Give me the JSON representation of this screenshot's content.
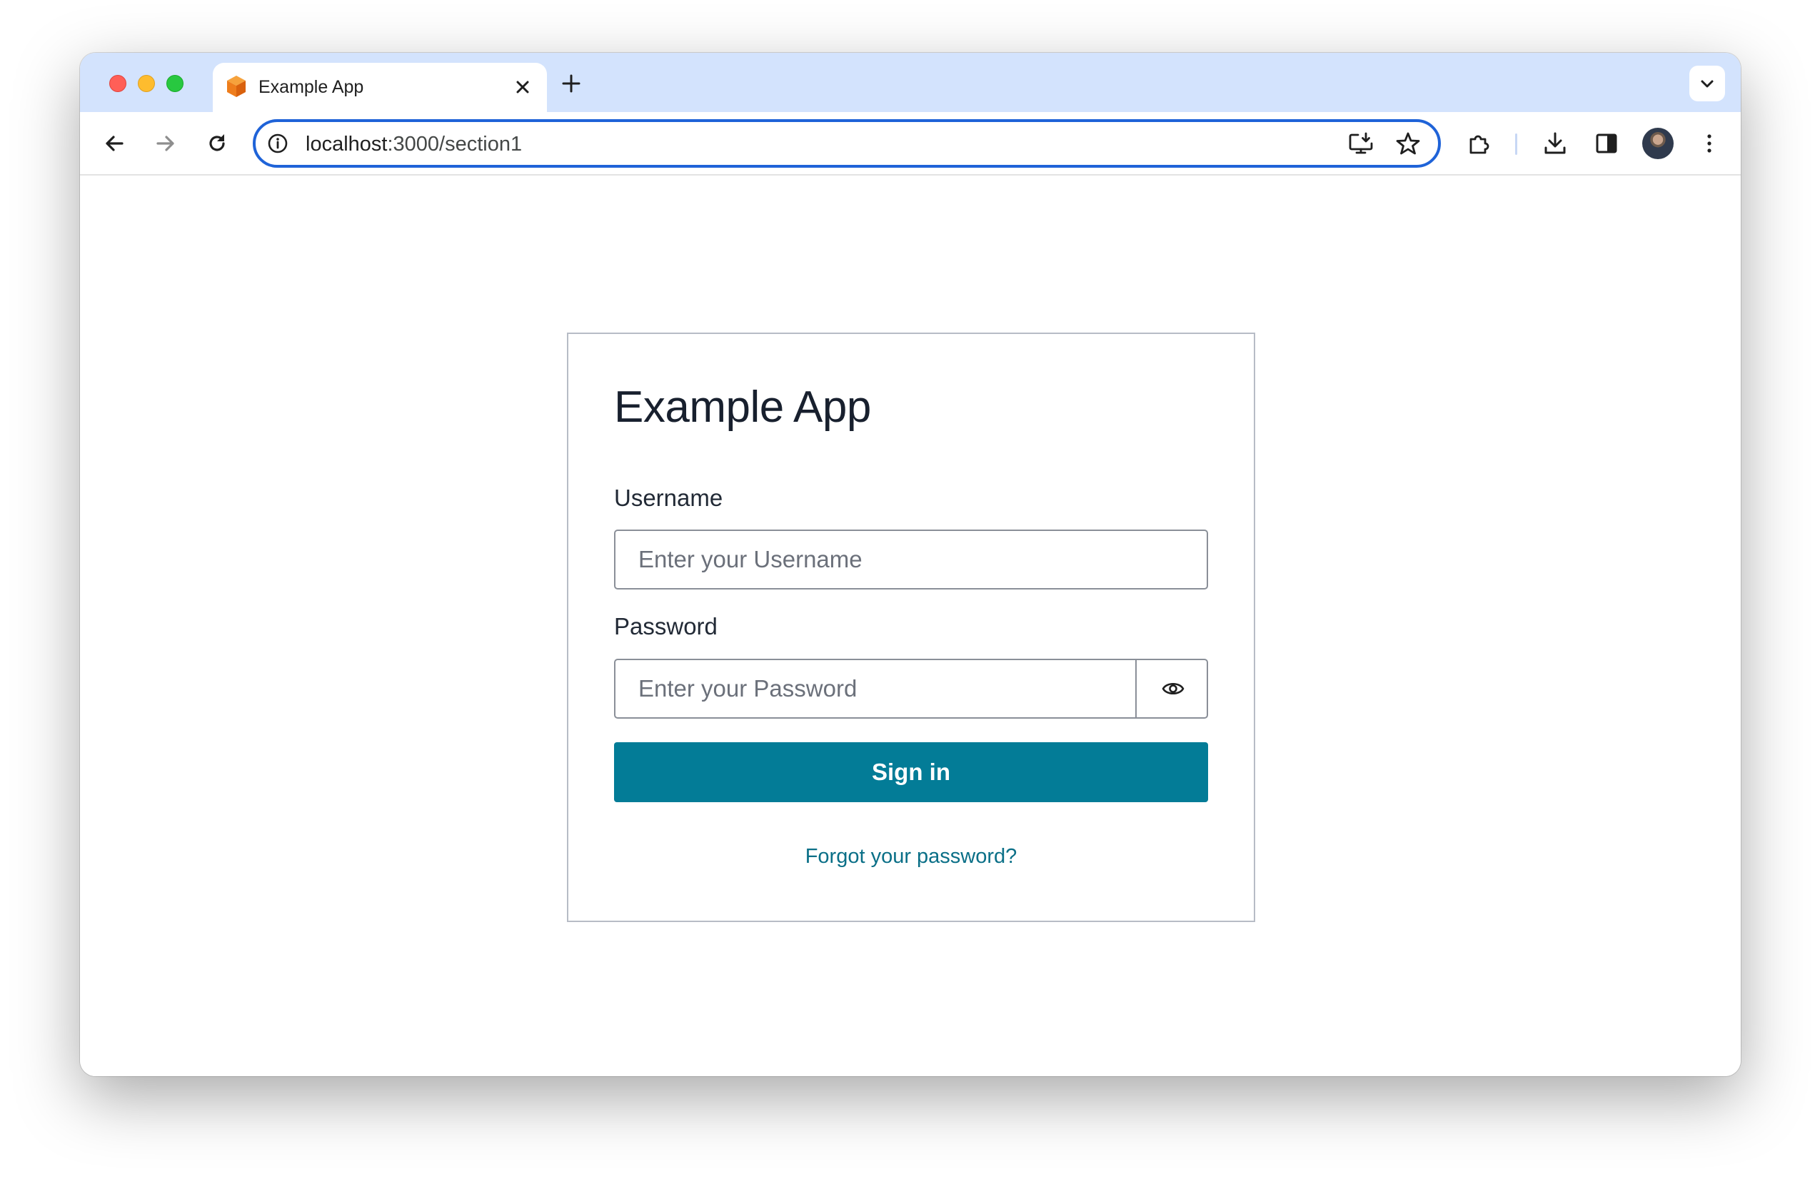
{
  "browser": {
    "tab": {
      "title": "Example App"
    },
    "address_bar": {
      "host": "localhost",
      "path": ":3000/section1"
    }
  },
  "login": {
    "title": "Example App",
    "username_label": "Username",
    "username_placeholder": "Enter your Username",
    "password_label": "Password",
    "password_placeholder": "Enter your Password",
    "sign_in_label": "Sign in",
    "forgot_password_label": "Forgot your password?"
  },
  "colors": {
    "tab_strip": "#d3e3fd",
    "omnibox_focus": "#1f63d8",
    "primary_button": "#037c97",
    "link": "#0a6f87"
  },
  "icons": {
    "favicon": "orange-cube-icon",
    "tab_close": "close-icon",
    "new_tab": "plus-icon",
    "tab_search": "chevron-down-icon",
    "back": "arrow-left-icon",
    "forward": "arrow-right-icon",
    "reload": "reload-icon",
    "site_info": "info-icon",
    "install": "install-app-icon",
    "bookmark": "star-icon",
    "extensions": "puzzle-icon",
    "downloads": "download-icon",
    "side_panel": "side-panel-icon",
    "menu": "kebab-menu-icon",
    "show_password": "eye-icon"
  }
}
